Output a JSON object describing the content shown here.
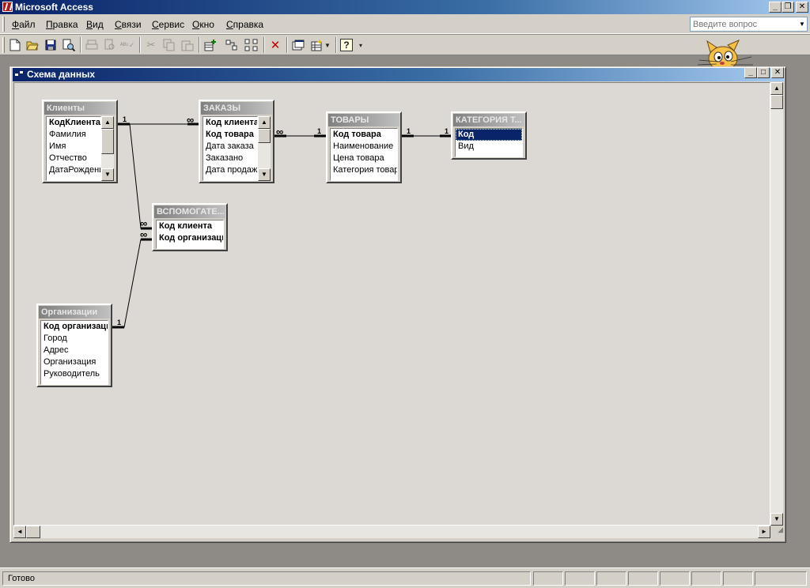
{
  "app": {
    "title": "Microsoft Access"
  },
  "menu": [
    "Файл",
    "Правка",
    "Вид",
    "Связи",
    "Сервис",
    "Окно",
    "Справка"
  ],
  "ask_box": {
    "placeholder": "Введите вопрос"
  },
  "toolbar": [
    "new-icon",
    "open-icon",
    "save-icon",
    "search-file-icon",
    "print-icon",
    "print-preview-icon",
    "spelling-icon",
    "cut-icon",
    "copy-icon",
    "paste-icon",
    "show-table-icon",
    "show-direct-icon",
    "show-all-icon",
    "delete-icon",
    "new-object-icon",
    "help-icon"
  ],
  "window": {
    "title": "Схема данных"
  },
  "tables": {
    "clients": {
      "title": "Клиенты",
      "fields": [
        "КодКлиента",
        "Фамилия",
        "Имя",
        "Отчество",
        "ДатаРождения"
      ]
    },
    "orders": {
      "title": "ЗАКАЗЫ",
      "fields": [
        "Код клиента",
        "Код товара",
        "Дата заказа",
        "Заказано",
        "Дата продажи"
      ]
    },
    "goods": {
      "title": "ТОВАРЫ",
      "fields": [
        "Код товара",
        "Наименование",
        "Цена товара",
        "Категория товара"
      ]
    },
    "category": {
      "title": "КАТЕГОРИЯ Т...",
      "fields": [
        "Код",
        "Вид"
      ]
    },
    "helper": {
      "title": "ВСПОМОГАТЕ...",
      "fields": [
        "Код клиента",
        "Код организации"
      ]
    },
    "orgs": {
      "title": "Организации",
      "fields": [
        "Код организации",
        "Город",
        "Адрес",
        "Организация",
        "Руководитель"
      ]
    }
  },
  "relations": {
    "one": "1",
    "many": "∞"
  },
  "status": {
    "text": "Готово"
  },
  "colors": {
    "titlebar_start": "#0a246a",
    "titlebar_end": "#a6caf0",
    "face": "#d4d0c8",
    "selection": "#0a246a"
  }
}
